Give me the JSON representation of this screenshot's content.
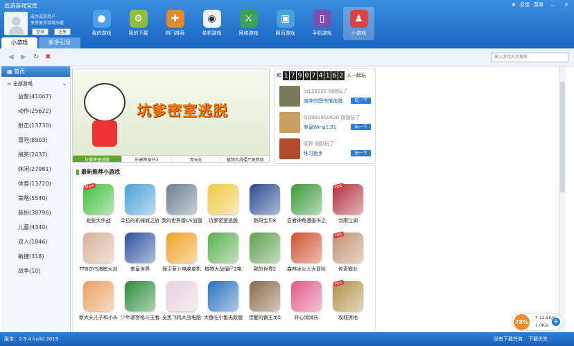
{
  "app": {
    "title": "逗游游戏宝库"
  },
  "window_controls": {
    "feedback": "反馈",
    "menu": "菜单",
    "minimize_icon": "minimize-icon",
    "close_icon": "close-icon"
  },
  "user": {
    "line1": "成为逗游用户",
    "line2": "享受更多游戏乐趣",
    "login": "登录",
    "register": "注册"
  },
  "nav": [
    {
      "label": "我的游戏",
      "icon": "person-icon",
      "color": "#4da0e8",
      "glyph": "●"
    },
    {
      "label": "我的下载",
      "icon": "gear-download-icon",
      "color": "#8fbf3a",
      "glyph": "⚙"
    },
    {
      "label": "热门推荐",
      "icon": "gamepad-plus-icon",
      "color": "#e08a2a",
      "glyph": "✚"
    },
    {
      "label": "单机游戏",
      "icon": "controller-icon",
      "color": "#eef2f7",
      "glyph": "◉"
    },
    {
      "label": "网络游戏",
      "icon": "sword-icon",
      "color": "#3aa05a",
      "glyph": "⚔"
    },
    {
      "label": "网页游戏",
      "icon": "web-game-icon",
      "color": "#4aa0d8",
      "glyph": "▣"
    },
    {
      "label": "手机游戏",
      "icon": "phone-icon",
      "color": "#7a4fb0",
      "glyph": "▯"
    },
    {
      "label": "小游戏",
      "icon": "joystick-icon",
      "color": "#e04040",
      "glyph": "♟"
    }
  ],
  "tabs": [
    {
      "label": "小游戏"
    },
    {
      "label": "新手引导"
    }
  ],
  "toolbar": {
    "search_placeholder": "输入游戏名称搜索"
  },
  "sidebar": {
    "home": "首页",
    "all": "全部游戏",
    "categories": [
      "益智(41047)",
      "动作(25622)",
      "射击(13730)",
      "冒险(8903)",
      "搞笑(2437)",
      "休闲(27981)",
      "体育(13720)",
      "策略(5540)",
      "装扮(38796)",
      "儿童(4340)",
      "双人(1846)",
      "敏捷(318)",
      "战争(10)"
    ]
  },
  "banner": {
    "title": "坑爹密室逃脱",
    "tabs": [
      "坑爹密室逃脱",
      "乐高降临节3",
      "青云志",
      "植物大战僵尸更新版"
    ],
    "active_tab": 0
  },
  "players": {
    "counter_prefix": "和",
    "digits": [
      "1",
      "7",
      "9",
      "0",
      "7",
      "4",
      "1",
      "6",
      "2"
    ],
    "counter_suffix": "人一起玩",
    "rows": [
      {
        "user": "lp139102 刚刚玩了",
        "game": "废弃的图书馆逃脱",
        "button": "玩一下",
        "color": "#7a7a5a"
      },
      {
        "user": "QQ981950620 刚刚玩了",
        "game": "拳皇Wing1.91",
        "button": "玩一下",
        "color": "#c9a060"
      },
      {
        "user": "昵称 刚刚玩了",
        "game": "练习跑步",
        "button": "玩一下",
        "color": "#b04a2a"
      }
    ]
  },
  "recommend": {
    "header": "最新推荐小游戏",
    "games": [
      {
        "label": "蛇蛇大作战",
        "color": "#3fbf3f",
        "hot": "New"
      },
      {
        "label": "朵拉的机械城之旅",
        "color": "#4aa0d8",
        "hot": ""
      },
      {
        "label": "我的世界版CS加强",
        "color": "#6a8090",
        "hot": ""
      },
      {
        "label": "坑爹密室逃脱",
        "color": "#f0c840",
        "hot": ""
      },
      {
        "label": "数码宝贝8",
        "color": "#2a4a90",
        "hot": ""
      },
      {
        "label": "忍者神龟漫画书之",
        "color": "#3a9a3a",
        "hot": ""
      },
      {
        "label": "剑雨江湖",
        "color": "#b03040",
        "hot": "Hot"
      },
      {
        "label": "TFBOYS海底大战",
        "color": "#d8b098",
        "hot": ""
      },
      {
        "label": "拳皇世界",
        "color": "#3050a0",
        "hot": ""
      },
      {
        "label": "保卫萝卜电脑单机",
        "color": "#f0a020",
        "hot": ""
      },
      {
        "label": "植物大战僵尸2电",
        "color": "#5ab050",
        "hot": ""
      },
      {
        "label": "我的世界2",
        "color": "#60a050",
        "hot": ""
      },
      {
        "label": "森林冰火人大冒险",
        "color": "#d05030",
        "hot": ""
      },
      {
        "label": "传奇霸业",
        "color": "#c09070",
        "hot": "Hot"
      },
      {
        "label": "新大头儿子和小头",
        "color": "#e8a060",
        "hot": ""
      },
      {
        "label": "少年骇客格斗王者",
        "color": "#2a8a3a",
        "hot": ""
      },
      {
        "label": "全民飞机大战电脑",
        "color": "#e8d0e0",
        "hot": ""
      },
      {
        "label": "大鱼吃小鱼无敌版",
        "color": "#2a70c0",
        "hot": ""
      },
      {
        "label": "觉醒的霸王龙5",
        "color": "#8a6a4a",
        "hot": ""
      },
      {
        "label": "开心消消乐",
        "color": "#e05a8a",
        "hot": ""
      },
      {
        "label": "攻城掠地",
        "color": "#b0904a",
        "hot": "Hot"
      }
    ]
  },
  "status": {
    "version": "版本：2.9.4 build 2019",
    "downloads": "没有下载任务",
    "manager": "下载优先"
  },
  "widget": {
    "percent": "78%",
    "up": "12.5K/s",
    "down": "0K/s",
    "plus": "+"
  }
}
